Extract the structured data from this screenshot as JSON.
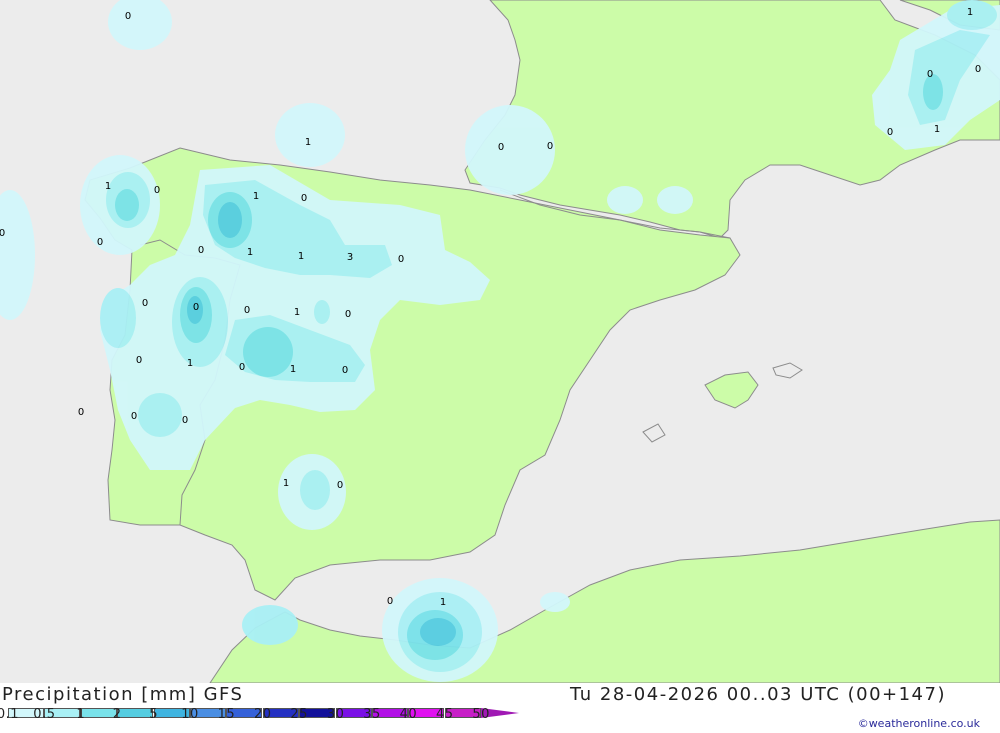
{
  "footer": {
    "title": "Precipitation [mm] GFS",
    "datetime": "Tu 28-04-2026 00..03 UTC (00+147)",
    "credit": "©weatheronline.co.uk"
  },
  "legend": {
    "ticks": [
      "0.1",
      "0.5",
      "1",
      "2",
      "5",
      "10",
      "15",
      "20",
      "25",
      "30",
      "35",
      "40",
      "45",
      "50"
    ],
    "colors": [
      "#d2f7fb",
      "#a9f0f5",
      "#79e2ea",
      "#55cde1",
      "#3fb4e0",
      "#4a8ee3",
      "#3561d9",
      "#2430c2",
      "#12109a",
      "#7a10e6",
      "#b20fe6",
      "#e010f0",
      "#c71ec7",
      "#a019b4"
    ]
  },
  "map": {
    "land_color": "#ccfca8",
    "sea_color": "#ececec",
    "precip_colors": [
      "#d2f7fb",
      "#a9f0f5",
      "#79e2ea",
      "#55cde1"
    ],
    "labels": [
      {
        "t": "0"
      },
      {
        "t": "1"
      },
      {
        "t": "0"
      },
      {
        "t": "0"
      },
      {
        "t": "1"
      },
      {
        "t": "0"
      },
      {
        "t": "1"
      },
      {
        "t": "1"
      },
      {
        "t": "0"
      },
      {
        "t": "0"
      },
      {
        "t": "0"
      },
      {
        "t": "0"
      },
      {
        "t": "1"
      },
      {
        "t": "0"
      },
      {
        "t": "1"
      },
      {
        "t": "1"
      },
      {
        "t": "0"
      },
      {
        "t": "0"
      },
      {
        "t": "3"
      },
      {
        "t": "0"
      },
      {
        "t": "0"
      },
      {
        "t": "0"
      },
      {
        "t": "0"
      },
      {
        "t": "1"
      },
      {
        "t": "0"
      },
      {
        "t": "1"
      },
      {
        "t": "1"
      },
      {
        "t": "0"
      },
      {
        "t": "0"
      },
      {
        "t": "0"
      },
      {
        "t": "0"
      },
      {
        "t": "0"
      },
      {
        "t": "0"
      },
      {
        "t": "1"
      },
      {
        "t": "0"
      },
      {
        "t": "0"
      },
      {
        "t": "1"
      }
    ]
  }
}
